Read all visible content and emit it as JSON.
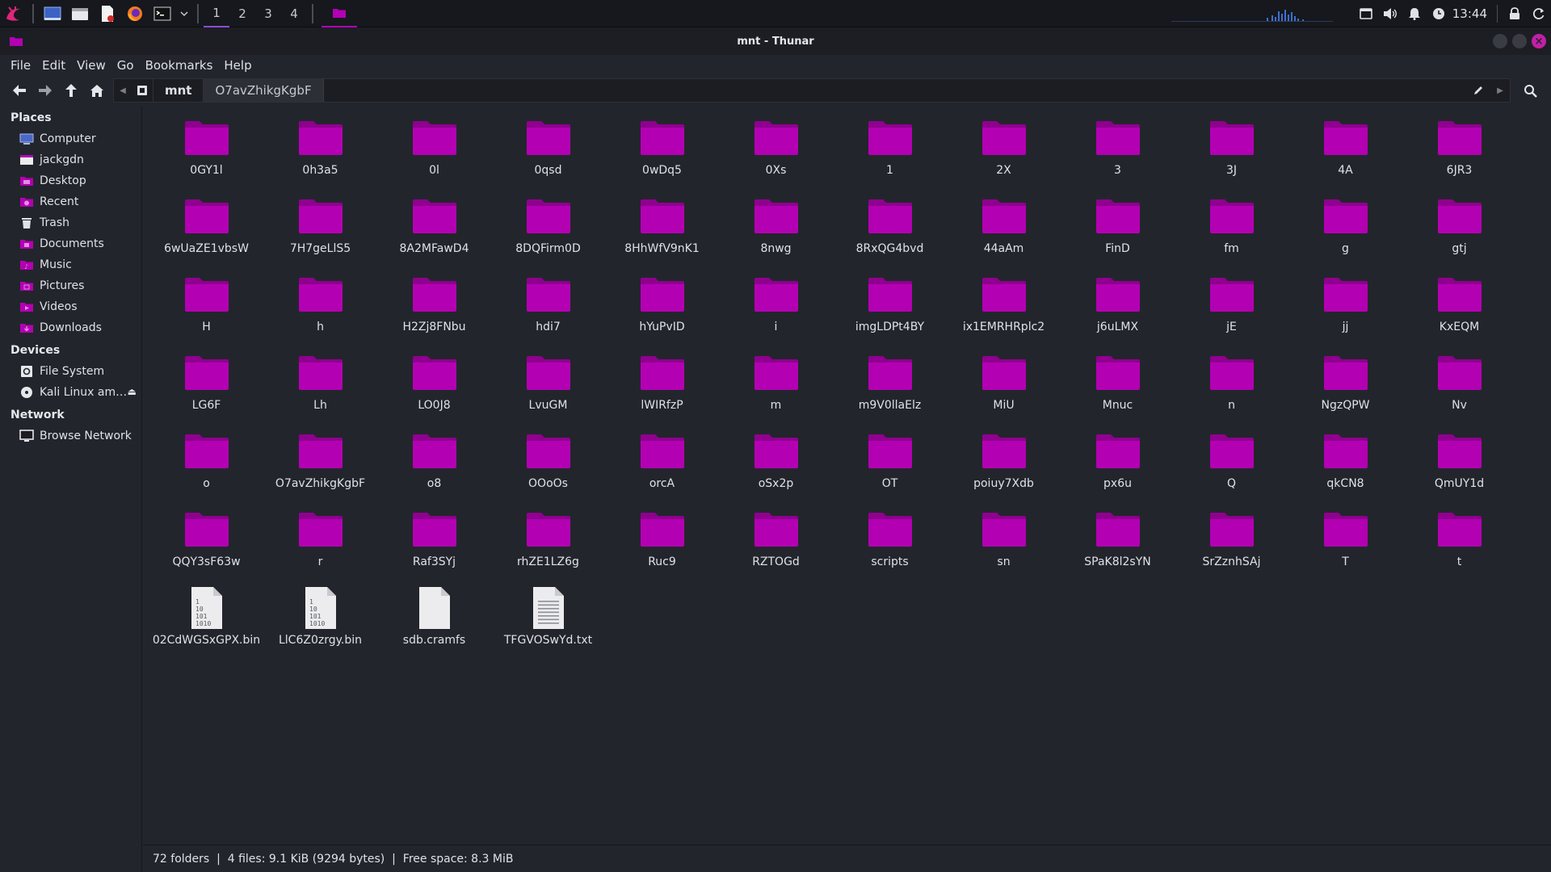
{
  "panel": {
    "workspaces": [
      "1",
      "2",
      "3",
      "4"
    ],
    "active_workspace": "1",
    "clock": "13:44"
  },
  "window": {
    "title": "mnt - Thunar"
  },
  "menubar": [
    "File",
    "Edit",
    "View",
    "Go",
    "Bookmarks",
    "Help"
  ],
  "pathbar": {
    "root_label": "mnt",
    "current_label": "O7avZhikgKgbF"
  },
  "sidebar": {
    "sections": [
      {
        "header": "Places",
        "items": [
          {
            "label": "Computer",
            "icon": "computer-icon"
          },
          {
            "label": "jackgdn",
            "icon": "home-folder-icon"
          },
          {
            "label": "Desktop",
            "icon": "desktop-icon"
          },
          {
            "label": "Recent",
            "icon": "recent-icon"
          },
          {
            "label": "Trash",
            "icon": "trash-icon"
          },
          {
            "label": "Documents",
            "icon": "documents-icon"
          },
          {
            "label": "Music",
            "icon": "music-icon"
          },
          {
            "label": "Pictures",
            "icon": "pictures-icon"
          },
          {
            "label": "Videos",
            "icon": "videos-icon"
          },
          {
            "label": "Downloads",
            "icon": "downloads-icon"
          }
        ]
      },
      {
        "header": "Devices",
        "items": [
          {
            "label": "File System",
            "icon": "filesystem-icon"
          },
          {
            "label": "Kali Linux am…",
            "icon": "optical-disc-icon",
            "eject": true
          }
        ]
      },
      {
        "header": "Network",
        "items": [
          {
            "label": "Browse Network",
            "icon": "network-icon"
          }
        ]
      }
    ]
  },
  "files": [
    {
      "name": "0GY1l",
      "type": "folder"
    },
    {
      "name": "0h3a5",
      "type": "folder"
    },
    {
      "name": "0l",
      "type": "folder"
    },
    {
      "name": "0qsd",
      "type": "folder"
    },
    {
      "name": "0wDq5",
      "type": "folder"
    },
    {
      "name": "0Xs",
      "type": "folder"
    },
    {
      "name": "1",
      "type": "folder"
    },
    {
      "name": "2X",
      "type": "folder"
    },
    {
      "name": "3",
      "type": "folder"
    },
    {
      "name": "3J",
      "type": "folder"
    },
    {
      "name": "4A",
      "type": "folder"
    },
    {
      "name": "6JR3",
      "type": "folder"
    },
    {
      "name": "6wUaZE1vbsW",
      "type": "folder"
    },
    {
      "name": "7H7geLlS5",
      "type": "folder"
    },
    {
      "name": "8A2MFawD4",
      "type": "folder"
    },
    {
      "name": "8DQFirm0D",
      "type": "folder"
    },
    {
      "name": "8HhWfV9nK1",
      "type": "folder"
    },
    {
      "name": "8nwg",
      "type": "folder"
    },
    {
      "name": "8RxQG4bvd",
      "type": "folder"
    },
    {
      "name": "44aAm",
      "type": "folder"
    },
    {
      "name": "FinD",
      "type": "folder"
    },
    {
      "name": "fm",
      "type": "folder"
    },
    {
      "name": "g",
      "type": "folder"
    },
    {
      "name": "gtj",
      "type": "folder"
    },
    {
      "name": "H",
      "type": "folder"
    },
    {
      "name": "h",
      "type": "folder"
    },
    {
      "name": "H2Zj8FNbu",
      "type": "folder"
    },
    {
      "name": "hdi7",
      "type": "folder"
    },
    {
      "name": "hYuPvID",
      "type": "folder"
    },
    {
      "name": "i",
      "type": "folder"
    },
    {
      "name": "imgLDPt4BY",
      "type": "folder"
    },
    {
      "name": "ix1EMRHRplc2",
      "type": "folder"
    },
    {
      "name": "j6uLMX",
      "type": "folder"
    },
    {
      "name": "jE",
      "type": "folder"
    },
    {
      "name": "jj",
      "type": "folder"
    },
    {
      "name": "KxEQM",
      "type": "folder"
    },
    {
      "name": "LG6F",
      "type": "folder"
    },
    {
      "name": "Lh",
      "type": "folder"
    },
    {
      "name": "LO0J8",
      "type": "folder"
    },
    {
      "name": "LvuGM",
      "type": "folder"
    },
    {
      "name": "lWIRfzP",
      "type": "folder"
    },
    {
      "name": "m",
      "type": "folder"
    },
    {
      "name": "m9V0llaElz",
      "type": "folder"
    },
    {
      "name": "MiU",
      "type": "folder"
    },
    {
      "name": "Mnuc",
      "type": "folder"
    },
    {
      "name": "n",
      "type": "folder"
    },
    {
      "name": "NgzQPW",
      "type": "folder"
    },
    {
      "name": "Nv",
      "type": "folder"
    },
    {
      "name": "o",
      "type": "folder"
    },
    {
      "name": "O7avZhikgKgbF",
      "type": "folder"
    },
    {
      "name": "o8",
      "type": "folder"
    },
    {
      "name": "OOoOs",
      "type": "folder"
    },
    {
      "name": "orcA",
      "type": "folder"
    },
    {
      "name": "oSx2p",
      "type": "folder"
    },
    {
      "name": "OT",
      "type": "folder"
    },
    {
      "name": "poiuy7Xdb",
      "type": "folder"
    },
    {
      "name": "px6u",
      "type": "folder"
    },
    {
      "name": "Q",
      "type": "folder"
    },
    {
      "name": "qkCN8",
      "type": "folder"
    },
    {
      "name": "QmUY1d",
      "type": "folder"
    },
    {
      "name": "QQY3sF63w",
      "type": "folder"
    },
    {
      "name": "r",
      "type": "folder"
    },
    {
      "name": "Raf3SYj",
      "type": "folder"
    },
    {
      "name": "rhZE1LZ6g",
      "type": "folder"
    },
    {
      "name": "Ruc9",
      "type": "folder"
    },
    {
      "name": "RZTOGd",
      "type": "folder"
    },
    {
      "name": "scripts",
      "type": "folder"
    },
    {
      "name": "sn",
      "type": "folder"
    },
    {
      "name": "SPaK8l2sYN",
      "type": "folder"
    },
    {
      "name": "SrZznhSAj",
      "type": "folder"
    },
    {
      "name": "T",
      "type": "folder"
    },
    {
      "name": "t",
      "type": "folder"
    },
    {
      "name": "02CdWGSxGPX.bin",
      "type": "binary"
    },
    {
      "name": "LlC6Z0zrgy.bin",
      "type": "binary"
    },
    {
      "name": "sdb.cramfs",
      "type": "blank"
    },
    {
      "name": "TFGVOSwYd.txt",
      "type": "text"
    }
  ],
  "statusbar": {
    "text": "72 folders  |  4 files: 9.1 KiB (9294 bytes)  |  Free space: 8.3 MiB"
  },
  "colors": {
    "folder": "#b300b3",
    "folder_tab": "#8f008f",
    "background": "#23252c",
    "accent": "#c21fa6"
  }
}
